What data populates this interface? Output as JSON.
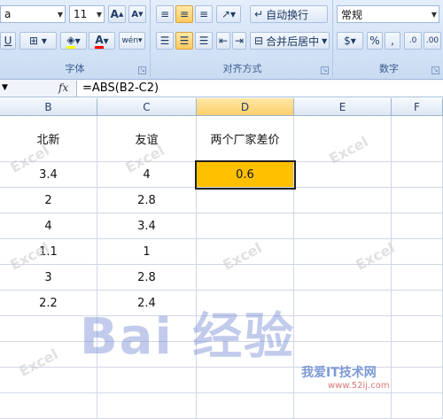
{
  "ribbon": {
    "font_name": "a",
    "font_size": "11",
    "font_group_label": "字体",
    "align_group_label": "对齐方式",
    "number_group_label": "数字",
    "wrap_text": "自动换行",
    "merge_center": "合并后居中",
    "number_format": "常规",
    "percent": "%",
    "comma": ",",
    "inc_decimal": ".0",
    "dec_decimal": ".00"
  },
  "formula_bar": {
    "fx": "fx",
    "formula": "=ABS(B2-C2)"
  },
  "columns": [
    "B",
    "C",
    "D",
    "E",
    "F"
  ],
  "rows": [
    [
      "北新",
      "友谊",
      "两个厂家差价"
    ],
    [
      "3.4",
      "4",
      "0.6"
    ],
    [
      "2",
      "2.8",
      ""
    ],
    [
      "4",
      "3.4",
      ""
    ],
    [
      "1.1",
      "1",
      ""
    ],
    [
      "3",
      "2.8",
      ""
    ],
    [
      "2.2",
      "2.4",
      ""
    ]
  ],
  "watermarks": {
    "excel": "Excel",
    "baidu": "Bai 经验",
    "site": "我爱IT技术网",
    "site_url": "www.52ij.com"
  },
  "accent_colors": {
    "selection": "#ffc000",
    "ribbon": "#d4e3f6"
  }
}
